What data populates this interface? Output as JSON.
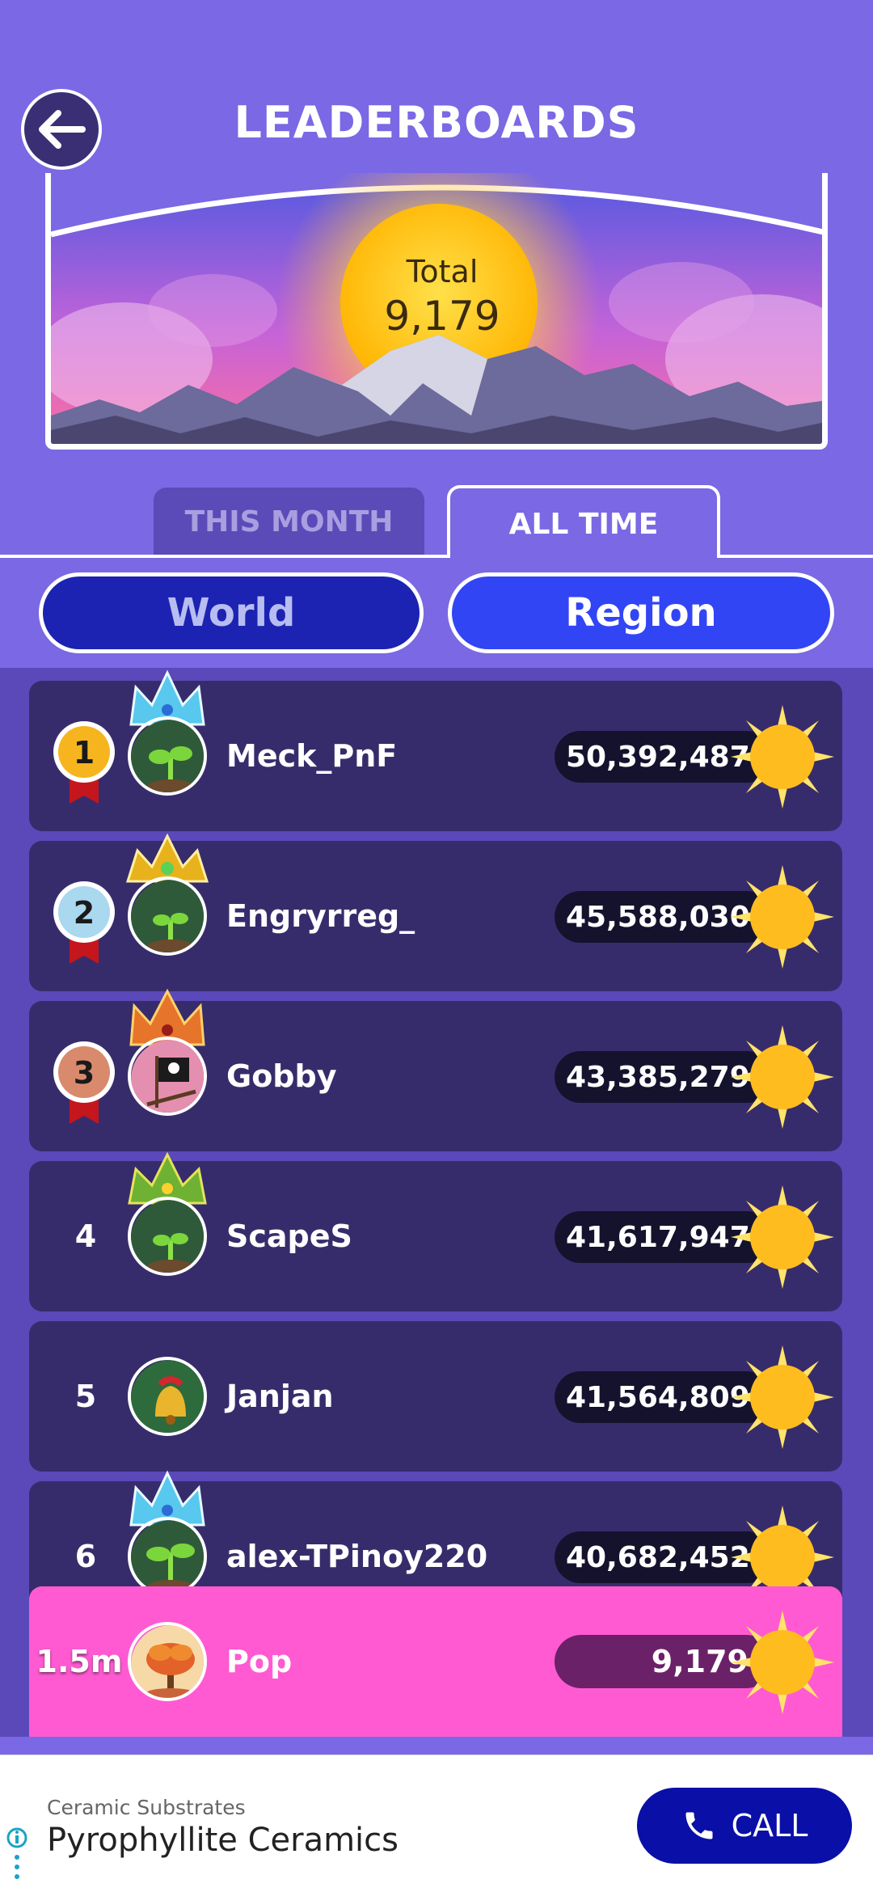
{
  "header": {
    "title": "LEADERBOARDS",
    "total_label": "Total",
    "total_value": "9,179"
  },
  "tabs": [
    {
      "label": "THIS MONTH",
      "active": false
    },
    {
      "label": "ALL TIME",
      "active": true
    }
  ],
  "filters": [
    {
      "label": "World",
      "active": false
    },
    {
      "label": "Region",
      "active": true
    }
  ],
  "leaderboard": [
    {
      "rank": "1",
      "name": "Meck_PnF",
      "score": "50,392,487",
      "medal": "gold",
      "crown": "ice",
      "avatar": "sprout-avatar"
    },
    {
      "rank": "2",
      "name": "Engryrreg_",
      "score": "45,588,030",
      "medal": "silver",
      "crown": "gold",
      "avatar": "sprout-avatar"
    },
    {
      "rank": "3",
      "name": "Gobby",
      "score": "43,385,279",
      "medal": "bronze",
      "crown": "fire",
      "avatar": "pirate-flag-avatar"
    },
    {
      "rank": "4",
      "name": "ScapeS",
      "score": "41,617,947",
      "medal": null,
      "crown": "leaf",
      "avatar": "sprout-avatar"
    },
    {
      "rank": "5",
      "name": "Janjan",
      "score": "41,564,809",
      "medal": null,
      "crown": null,
      "avatar": "bell-avatar"
    },
    {
      "rank": "6",
      "name": "alex-TPinoy220",
      "score": "40,682,452",
      "medal": null,
      "crown": "ice",
      "avatar": "sprout-avatar"
    }
  ],
  "current_user": {
    "rank": "1.5m",
    "name": "Pop",
    "score": "9,179",
    "avatar": "autumn-tree-avatar"
  },
  "ad": {
    "category": "Ceramic Substrates",
    "title": "Pyrophyllite Ceramics",
    "button_label": "CALL"
  },
  "colors": {
    "background": "#7866e3",
    "row": "#372c6b",
    "highlight_row": "#ff5ad2",
    "world_pill": "#1c23b2",
    "region_pill": "#3245f5",
    "call_button": "#0a0fa8"
  }
}
